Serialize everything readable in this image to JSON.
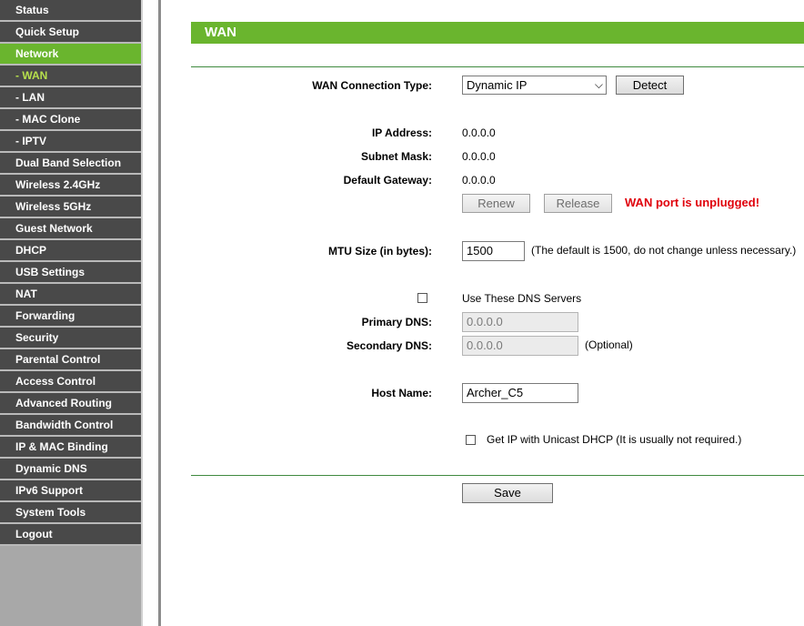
{
  "sidebar": {
    "items": [
      {
        "label": "Status"
      },
      {
        "label": "Quick Setup"
      },
      {
        "label": "Network"
      },
      {
        "label": "- WAN"
      },
      {
        "label": "- LAN"
      },
      {
        "label": "- MAC Clone"
      },
      {
        "label": "- IPTV"
      },
      {
        "label": "Dual Band Selection"
      },
      {
        "label": "Wireless 2.4GHz"
      },
      {
        "label": "Wireless 5GHz"
      },
      {
        "label": "Guest Network"
      },
      {
        "label": "DHCP"
      },
      {
        "label": "USB Settings"
      },
      {
        "label": "NAT"
      },
      {
        "label": "Forwarding"
      },
      {
        "label": "Security"
      },
      {
        "label": "Parental Control"
      },
      {
        "label": "Access Control"
      },
      {
        "label": "Advanced Routing"
      },
      {
        "label": "Bandwidth Control"
      },
      {
        "label": "IP & MAC Binding"
      },
      {
        "label": "Dynamic DNS"
      },
      {
        "label": "IPv6 Support"
      },
      {
        "label": "System Tools"
      },
      {
        "label": "Logout"
      }
    ]
  },
  "page": {
    "title": "WAN"
  },
  "wan": {
    "connection_type_label": "WAN Connection Type:",
    "connection_type_value": "Dynamic IP",
    "detect_label": "Detect",
    "ip_label": "IP Address:",
    "ip_value": "0.0.0.0",
    "mask_label": "Subnet Mask:",
    "mask_value": "0.0.0.0",
    "gateway_label": "Default Gateway:",
    "gateway_value": "0.0.0.0",
    "renew_label": "Renew",
    "release_label": "Release",
    "status_text": "WAN port is unplugged!",
    "mtu_label": "MTU Size (in bytes):",
    "mtu_value": "1500",
    "mtu_hint": "(The default is 1500, do not change unless necessary.)",
    "dns_checkbox_label": "Use These DNS Servers",
    "primary_dns_label": "Primary DNS:",
    "primary_dns_value": "0.0.0.0",
    "secondary_dns_label": "Secondary DNS:",
    "secondary_dns_value": "0.0.0.0",
    "secondary_hint": "(Optional)",
    "host_label": "Host Name:",
    "host_value": "Archer_C5",
    "unicast_label": "Get IP with Unicast DHCP (It is usually not required.)",
    "save_label": "Save"
  },
  "colors": {
    "accent_green": "#6ab52e",
    "sidebar_dark": "#494949",
    "status_red": "#e0000b"
  }
}
